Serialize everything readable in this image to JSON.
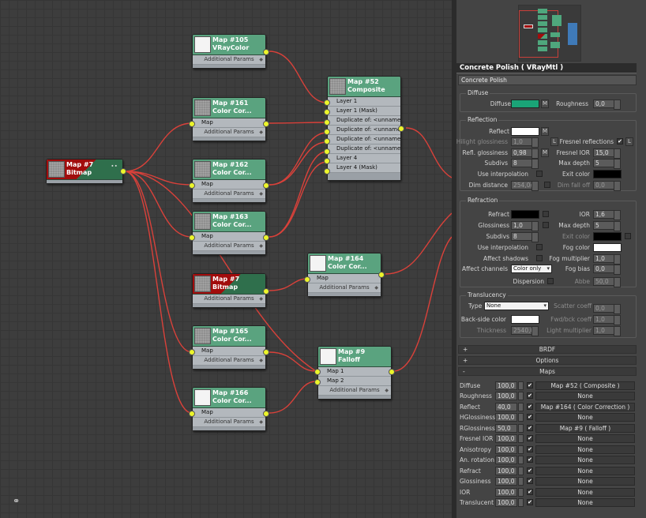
{
  "graph": {
    "nodes": {
      "n105": {
        "title": "Map #105",
        "sub": "VRayColor",
        "rows": [
          "Additional Params"
        ]
      },
      "n161": {
        "title": "Map #161",
        "sub": "Color Cor...",
        "rows": [
          "Map",
          "Additional Params"
        ]
      },
      "n162": {
        "title": "Map #162",
        "sub": "Color Cor...",
        "rows": [
          "Map",
          "Additional Params"
        ]
      },
      "n163": {
        "title": "Map #163",
        "sub": "Color Cor...",
        "rows": [
          "Map",
          "Additional Params"
        ]
      },
      "n7b": {
        "title": "Map #7",
        "sub": "Bitmap",
        "rows": [
          "Additional Params"
        ]
      },
      "n165": {
        "title": "Map #165",
        "sub": "Color Cor...",
        "rows": [
          "Map",
          "Additional Params"
        ]
      },
      "n166": {
        "title": "Map #166",
        "sub": "Color Cor...",
        "rows": [
          "Map",
          "Additional Params"
        ]
      },
      "n7": {
        "title": "Map #7",
        "sub": "Bitmap"
      },
      "n52": {
        "title": "Map #52",
        "sub": "Composite",
        "rows": [
          "Layer 1",
          "Layer 1 (Mask)",
          "Duplicate of: <unnamed l...",
          "Duplicate of: <unnamed l...",
          "Duplicate of: <unnamed l...",
          "Duplicate of: <unnamed l...",
          "Layer 4",
          "Layer 4 (Mask)"
        ]
      },
      "n164": {
        "title": "Map #164",
        "sub": "Color Cor...",
        "rows": [
          "Map",
          "Additional Params"
        ]
      },
      "n9": {
        "title": "Map #9",
        "sub": "Falloff",
        "rows": [
          "Map 1",
          "Map 2",
          "Additional Params"
        ]
      }
    }
  },
  "panel": {
    "title": "Concrete Polish  ( VRayMtl )",
    "material_name": "Concrete Polish",
    "diffuse": {
      "group": "Diffuse",
      "diffuse_label": "Diffuse",
      "diffuse_color": "#1aa477",
      "roughness_label": "Roughness",
      "roughness": "0,0",
      "m": "M"
    },
    "reflection": {
      "group": "Reflection",
      "reflect_label": "Reflect",
      "reflect_color": "#ffffff",
      "hilight_label": "Hilight glossiness",
      "hilight": "1,0",
      "l": "L",
      "fresnel_label": "Fresnel reflections",
      "fresnel_check": "✔",
      "refl_gloss_label": "Refl. glossiness",
      "refl_gloss": "0,98",
      "fresnel_ior_label": "Fresnel IOR",
      "fresnel_ior": "15,0",
      "subdivs_label": "Subdivs",
      "subdivs": "8",
      "max_depth_label": "Max depth",
      "max_depth": "5",
      "use_interp_label": "Use interpolation",
      "exit_color_label": "Exit color",
      "exit_color": "#000000",
      "dim_distance_label": "Dim distance",
      "dim_distance": "254,0c",
      "dim_falloff_label": "Dim fall off",
      "dim_falloff": "0,0"
    },
    "refraction": {
      "group": "Refraction",
      "refract_label": "Refract",
      "refract_color": "#000000",
      "ior_label": "IOR",
      "ior": "1,6",
      "gloss_label": "Glossiness",
      "gloss": "1,0",
      "max_depth_label": "Max depth",
      "max_depth": "5",
      "subdivs_label": "Subdivs",
      "subdivs": "8",
      "exit_color_label": "Exit color",
      "exit_color": "#000000",
      "use_interp_label": "Use interpolation",
      "fog_color_label": "Fog color",
      "fog_color": "#ffffff",
      "affect_shadows_label": "Affect shadows",
      "fog_mult_label": "Fog multiplier",
      "fog_mult": "1,0",
      "affect_channels_label": "Affect channels",
      "affect_channels": "Color only",
      "fog_bias_label": "Fog bias",
      "fog_bias": "0,0",
      "dispersion_label": "Dispersion",
      "abbe_label": "Abbe",
      "abbe": "50,0"
    },
    "translucency": {
      "group": "Translucency",
      "type_label": "Type",
      "type": "None",
      "scatter_label": "Scatter coeff",
      "scatter": "0,0",
      "backside_label": "Back-side color",
      "backside_color": "#ffffff",
      "fwd_label": "Fwd/bck coeff",
      "fwd": "1,0",
      "thickness_label": "Thickness",
      "thickness": "2540,0",
      "light_mult_label": "Light multiplier",
      "light_mult": "1,0"
    },
    "rollouts": {
      "brdf": "BRDF",
      "options": "Options",
      "maps": "Maps",
      "plus": "+",
      "minus": "-"
    },
    "maps": [
      {
        "label": "Diffuse",
        "amount": "100,0",
        "check": "✔",
        "map": "Map #52  ( Composite )"
      },
      {
        "label": "Roughness",
        "amount": "100,0",
        "check": "✔",
        "map": "None"
      },
      {
        "label": "Reflect",
        "amount": "40,0",
        "check": "✔",
        "map": "Map #164  ( Color Correction )"
      },
      {
        "label": "HGlossiness",
        "amount": "100,0",
        "check": "✔",
        "map": "None"
      },
      {
        "label": "RGlossiness",
        "amount": "50,0",
        "check": "✔",
        "map": "Map #9  ( Falloff )"
      },
      {
        "label": "Fresnel IOR",
        "amount": "100,0",
        "check": "✔",
        "map": "None"
      },
      {
        "label": "Anisotropy",
        "amount": "100,0",
        "check": "✔",
        "map": "None"
      },
      {
        "label": "An. rotation",
        "amount": "100,0",
        "check": "✔",
        "map": "None"
      },
      {
        "label": "Refract",
        "amount": "100,0",
        "check": "✔",
        "map": "None"
      },
      {
        "label": "Glossiness",
        "amount": "100,0",
        "check": "✔",
        "map": "None"
      },
      {
        "label": "IOR",
        "amount": "100,0",
        "check": "✔",
        "map": "None"
      },
      {
        "label": "Translucent",
        "amount": "100,0",
        "check": "✔",
        "map": "None"
      }
    ]
  },
  "icons": {
    "node_icon": "binoculars-icon",
    "node_icon_glyph": "⚭"
  }
}
